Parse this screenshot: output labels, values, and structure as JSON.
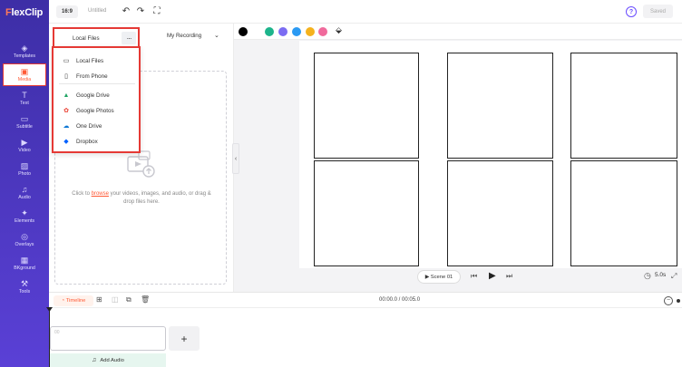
{
  "app": {
    "logo_first": "F",
    "logo_rest": "lexClip"
  },
  "sidebar": {
    "items": [
      {
        "label": "Templates",
        "icon": "layers-icon",
        "glyph": "◈"
      },
      {
        "label": "Media",
        "icon": "media-icon",
        "glyph": "▣",
        "active": true
      },
      {
        "label": "Text",
        "icon": "text-icon",
        "glyph": "T"
      },
      {
        "label": "Subtitle",
        "icon": "subtitle-icon",
        "glyph": "▭"
      },
      {
        "label": "Video",
        "icon": "video-icon",
        "glyph": "▶"
      },
      {
        "label": "Photo",
        "icon": "photo-icon",
        "glyph": "▨"
      },
      {
        "label": "Audio",
        "icon": "music-icon",
        "glyph": "♫"
      },
      {
        "label": "Elements",
        "icon": "elements-icon",
        "glyph": "✦"
      },
      {
        "label": "Overlays",
        "icon": "overlays-icon",
        "glyph": "◎"
      },
      {
        "label": "BKground",
        "icon": "background-icon",
        "glyph": "▦"
      },
      {
        "label": "Tools",
        "icon": "tools-icon",
        "glyph": "⚒"
      }
    ]
  },
  "topbar": {
    "ratio": "16:9",
    "title": "Untitled",
    "undo_icon": "↶",
    "redo_icon": "↷",
    "fullscreen_icon": "⛶",
    "help_icon": "?",
    "saved_label": "Saved"
  },
  "panel": {
    "source_label": "Local Files",
    "more_label": "···",
    "recording_label": "My Recording",
    "chevron": "⌄",
    "drop_text_before": "Click to ",
    "drop_text_link": "browse",
    "drop_text_after": " your videos, images, and audio, or drag & drop files here."
  },
  "menu": {
    "items": [
      {
        "label": "Local Files",
        "icon": "monitor-icon",
        "glyph": "▭",
        "color": "#333333"
      },
      {
        "label": "From Phone",
        "icon": "phone-icon",
        "glyph": "▯",
        "color": "#333333"
      },
      {
        "label": "Google Drive",
        "icon": "google-drive-icon",
        "glyph": "▲",
        "color": "#1fa463"
      },
      {
        "label": "Google Photos",
        "icon": "google-photos-icon",
        "glyph": "✿",
        "color": "#ea4335"
      },
      {
        "label": "One Drive",
        "icon": "onedrive-icon",
        "glyph": "☁",
        "color": "#0f78d4"
      },
      {
        "label": "Dropbox",
        "icon": "dropbox-icon",
        "glyph": "◆",
        "color": "#0061ff"
      }
    ]
  },
  "colors": {
    "swatches": [
      "#000000",
      "#1db48b",
      "#7b6cf2",
      "#2b9af3",
      "#f5b21d",
      "#f06a9c"
    ],
    "accent": "#ff5a36",
    "sidebar": "#4a37c2"
  },
  "editor": {
    "fill_icon": "⬙",
    "scene_label": "Scene 01",
    "play_icon": "▶",
    "prev_icon": "⏮",
    "next_icon": "⏭",
    "duration": "5.0s",
    "clock_icon": "◷",
    "expand_icon": "⤢"
  },
  "timeline": {
    "label": "Timeline",
    "time": "00:00.0 / 00:05.0",
    "zoom_minus": "−",
    "clip_number": "00",
    "add_scene": "+",
    "add_audio": "Add Audio",
    "audio_icon": "♫"
  }
}
